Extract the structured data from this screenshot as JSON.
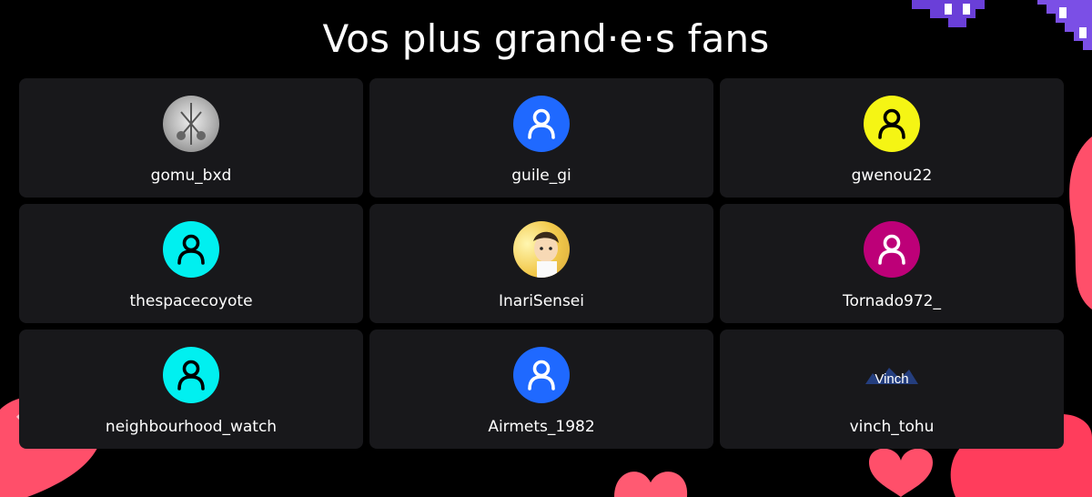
{
  "page": {
    "title": "Vos plus grand·e·s fans"
  },
  "fans": [
    {
      "name": "gomu_bxd",
      "avatar": "photo-avatar",
      "color": "#d9d9d9"
    },
    {
      "name": "guile_gi",
      "avatar": "default-user-icon",
      "color": "#1f69ff",
      "icon_color": "#ffffff"
    },
    {
      "name": "gwenou22",
      "avatar": "default-user-icon",
      "color": "#f5f514",
      "icon_color": "#000000"
    },
    {
      "name": "thespacecoyote",
      "avatar": "default-user-icon",
      "color": "#00f0f0",
      "icon_color": "#000000"
    },
    {
      "name": "InariSensei",
      "avatar": "anime-avatar",
      "color": "#f5d76e"
    },
    {
      "name": "Tornado972_",
      "avatar": "default-user-icon",
      "color": "#bd0078",
      "icon_color": "#ffffff"
    },
    {
      "name": "neighbourhood_watch",
      "avatar": "default-user-icon",
      "color": "#00f0f0",
      "icon_color": "#000000"
    },
    {
      "name": "Airmets_1982",
      "avatar": "default-user-icon",
      "color": "#1f69ff",
      "icon_color": "#ffffff"
    },
    {
      "name": "vinch_tohu",
      "avatar": "vinch-logo",
      "color": "#18181b",
      "logo_text": "Vinch"
    }
  ]
}
